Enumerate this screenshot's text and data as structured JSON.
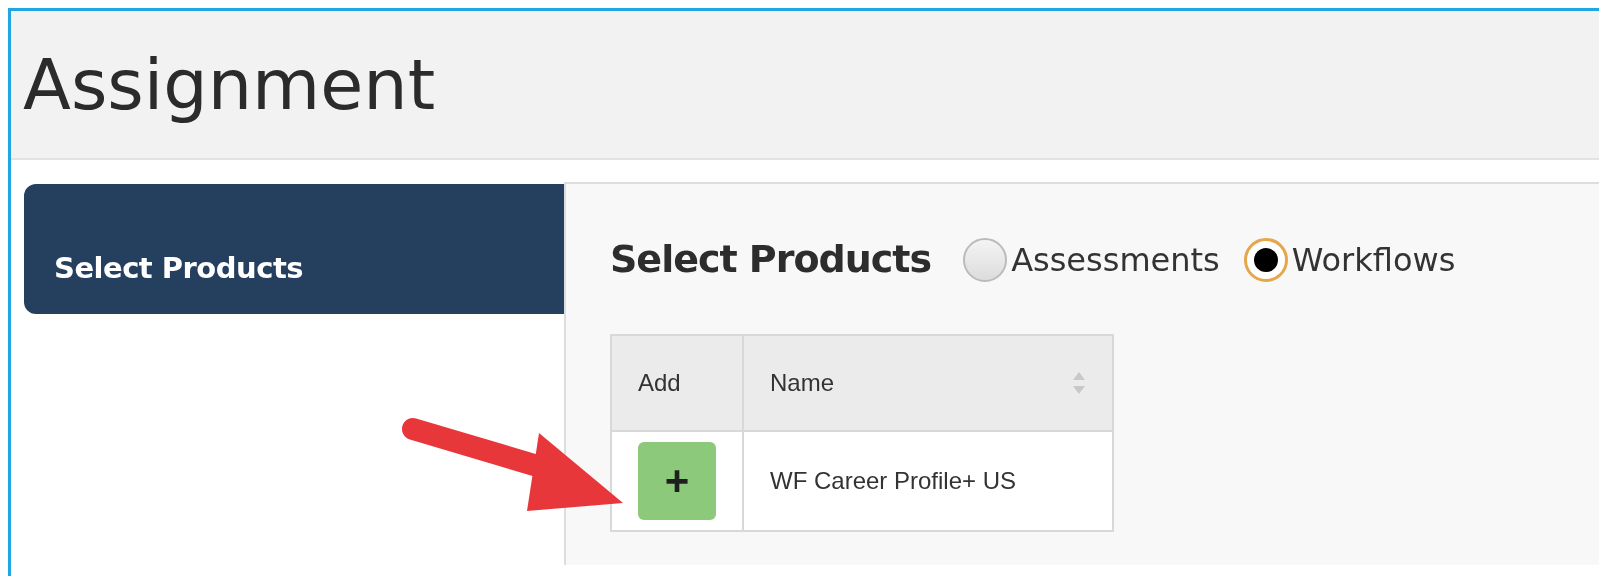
{
  "page": {
    "title": "Assignment"
  },
  "sidebar": {
    "items": [
      {
        "label": "Select Products",
        "selected": true
      }
    ]
  },
  "panel": {
    "heading": "Select Products",
    "product_types": [
      {
        "label": "Assessments",
        "selected": false
      },
      {
        "label": "Workflows",
        "selected": true
      }
    ],
    "table": {
      "columns": [
        {
          "label": "Add",
          "sortable": false
        },
        {
          "label": "Name",
          "sortable": true
        }
      ],
      "rows": [
        {
          "name": "WF Career Profile+ US",
          "add": "+"
        }
      ]
    }
  }
}
